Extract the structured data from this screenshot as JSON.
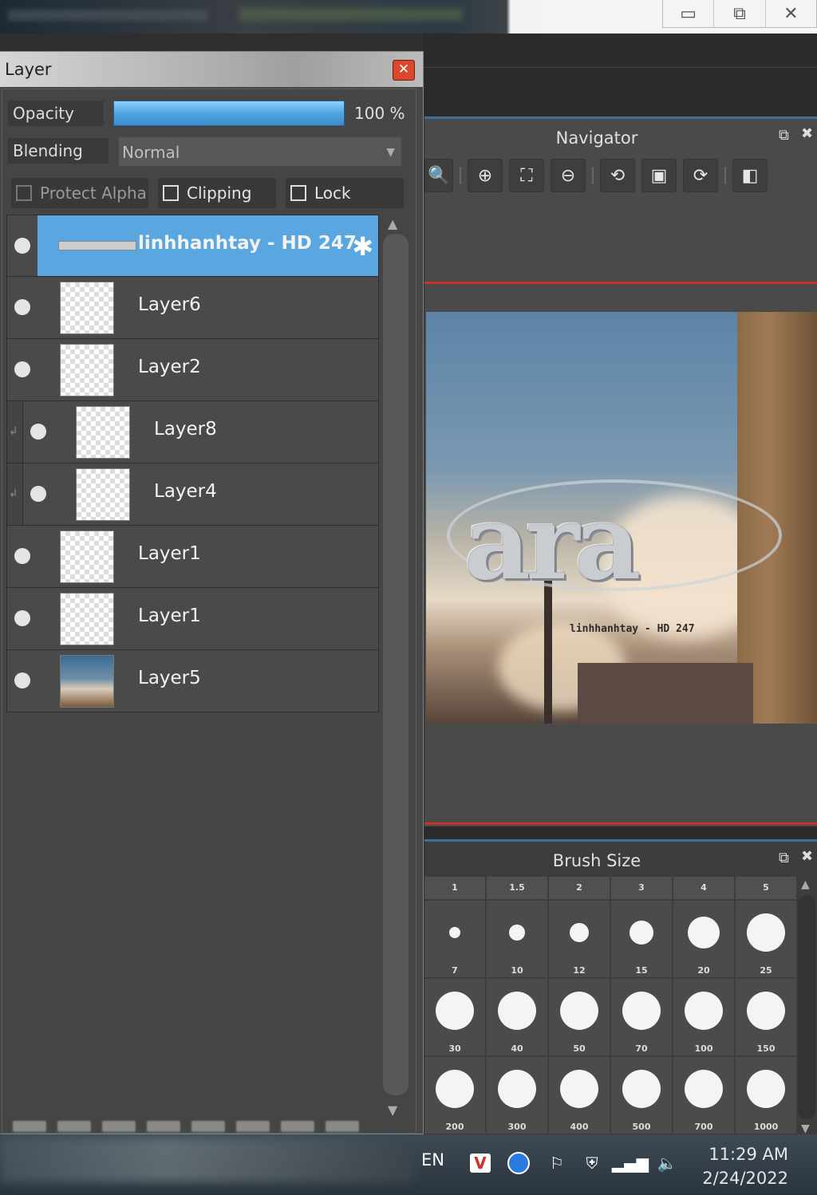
{
  "window_controls": {
    "minimize": "▭",
    "restore": "⧉",
    "close": "✕"
  },
  "layer_panel": {
    "title": "Layer",
    "close_glyph": "✕",
    "opacity_label": "Opacity",
    "opacity_value": "100 %",
    "opacity_fraction": 1.0,
    "blending_label": "Blending",
    "blending_value": "Normal",
    "protect_alpha_label": "Protect Alpha",
    "clipping_label": "Clipping",
    "lock_label": "Lock",
    "layers": [
      {
        "name": "linhhanhtay - HD 247"
      },
      {
        "name": "Layer6"
      },
      {
        "name": "Layer2"
      },
      {
        "name": "Layer8"
      },
      {
        "name": "Layer4"
      },
      {
        "name": "Layer1"
      },
      {
        "name": "Layer1"
      },
      {
        "name": "Layer5"
      }
    ]
  },
  "navigator": {
    "title": "Navigator",
    "canvas_text": "ara",
    "canvas_caption": "linhhanhtay - HD 247"
  },
  "brush_size": {
    "title": "Brush Size",
    "headers": [
      "1",
      "1.5",
      "2",
      "3",
      "4",
      "5"
    ],
    "rows": [
      [
        "7",
        "10",
        "12",
        "15",
        "20",
        "25"
      ],
      [
        "30",
        "40",
        "50",
        "70",
        "100",
        "150"
      ],
      [
        "200",
        "300",
        "400",
        "500",
        "700",
        "1000"
      ]
    ]
  },
  "taskbar": {
    "language": "EN",
    "time": "11:29 AM",
    "date": "2/24/2022"
  },
  "colors": {
    "accent_blue": "#5aa6e0",
    "close_red": "#d9472d",
    "divider_red": "#c8322c"
  }
}
